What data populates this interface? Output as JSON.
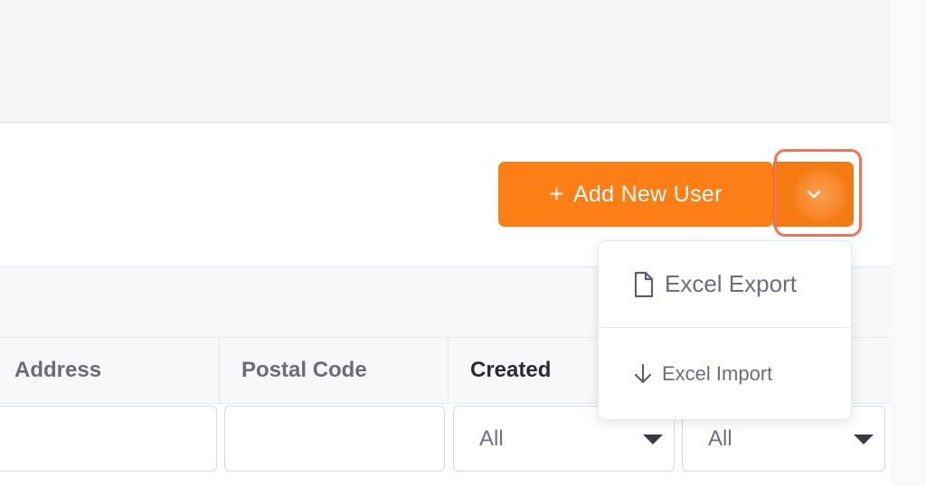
{
  "toolbar": {
    "add_button_label": "Add New User",
    "add_button_icon": "plus-icon",
    "toggle_icon": "chevron-down-icon",
    "accent_color": "#fd7e14",
    "focus_ring_color": "#f47255"
  },
  "table": {
    "columns": [
      {
        "label": "Address"
      },
      {
        "label": "Postal Code"
      },
      {
        "label": "Created"
      }
    ],
    "filters": [
      {
        "type": "text",
        "value": ""
      },
      {
        "type": "text",
        "value": ""
      },
      {
        "type": "select",
        "value": "All"
      },
      {
        "type": "select",
        "value": "All"
      }
    ]
  },
  "dropdown_menu": {
    "items": [
      {
        "label": "Excel Export",
        "icon": "file-icon"
      },
      {
        "label": "Excel Import",
        "icon": "arrow-down-icon"
      }
    ]
  }
}
